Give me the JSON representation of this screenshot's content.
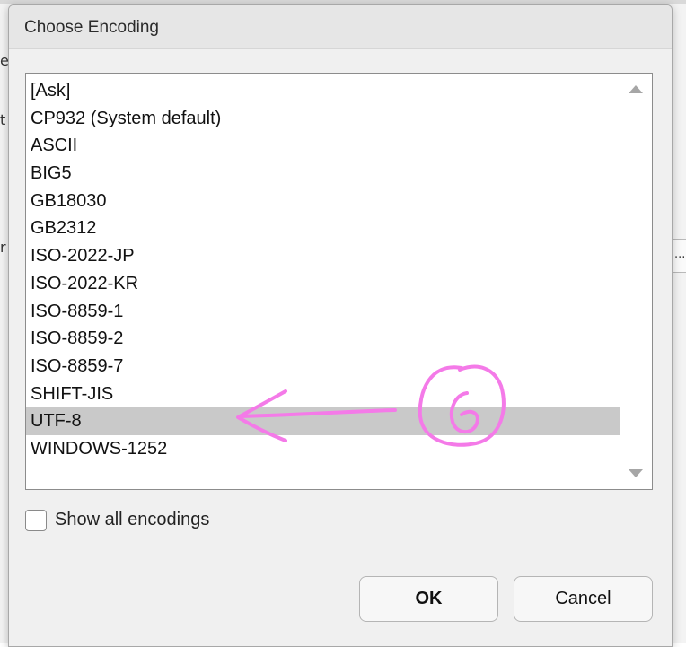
{
  "dialog": {
    "title": "Choose Encoding",
    "encodings": [
      "[Ask]",
      "CP932 (System default)",
      "ASCII",
      "BIG5",
      "GB18030",
      "GB2312",
      "ISO-2022-JP",
      "ISO-2022-KR",
      "ISO-8859-1",
      "ISO-8859-2",
      "ISO-8859-7",
      "SHIFT-JIS",
      "UTF-8",
      "WINDOWS-1252"
    ],
    "selected_encoding": "UTF-8",
    "show_all_label": "Show all encodings",
    "show_all_checked": false,
    "ok_label": "OK",
    "cancel_label": "Cancel"
  },
  "background": {
    "fragments": [
      "e",
      "t",
      "r"
    ],
    "right_button_label": "..."
  },
  "annotation": {
    "step_number": "6",
    "color": "#f47ae8"
  }
}
